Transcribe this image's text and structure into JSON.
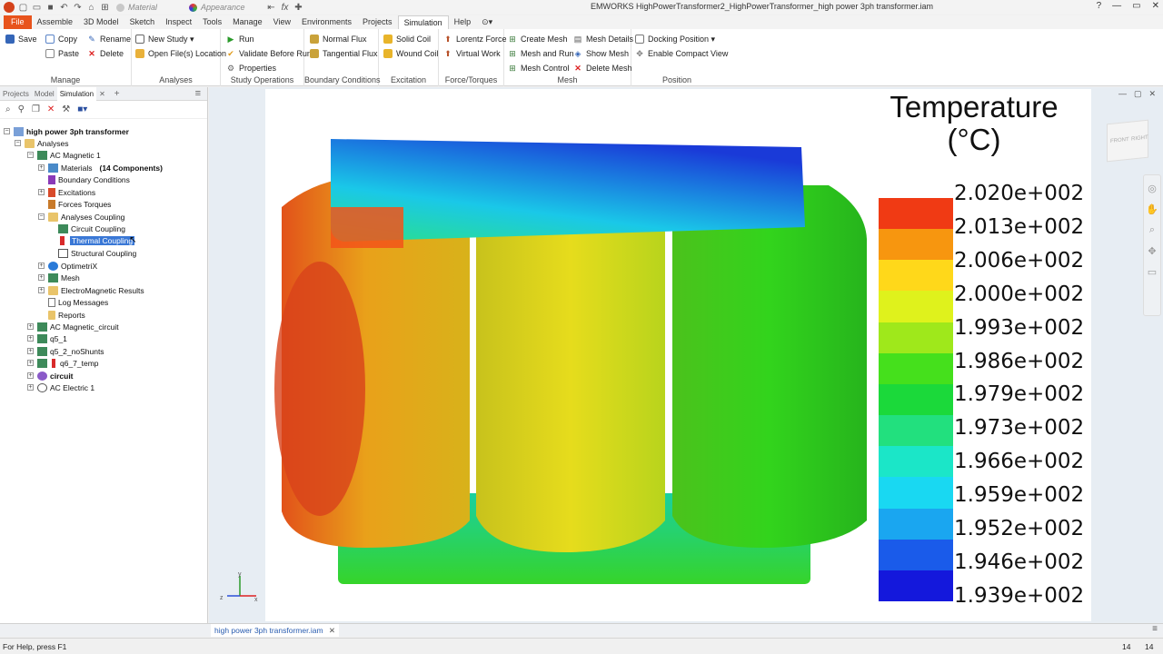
{
  "window": {
    "title": "EMWORKS   HighPowerTransformer2_HighPowerTransformer_high power 3ph transformer.iam",
    "material": "Material",
    "appearance": "Appearance",
    "fx": "fx",
    "help": "?",
    "minimize": "—",
    "restore": "▭",
    "close": "✕"
  },
  "tabs": [
    "File",
    "Assemble",
    "3D Model",
    "Sketch",
    "Inspect",
    "Tools",
    "Manage",
    "View",
    "Environments",
    "Projects",
    "Simulation",
    "Help"
  ],
  "active_tab": "Simulation",
  "ribbon": {
    "manage": {
      "label": "Manage",
      "save": "Save",
      "copy": "Copy",
      "paste": "Paste",
      "rename": "Rename",
      "delete": "Delete"
    },
    "analyses": {
      "label": "Analyses",
      "new_study": "New Study ▾",
      "open_location": "Open File(s) Location"
    },
    "study_ops": {
      "label": "Study Operations",
      "run": "Run",
      "validate": "Validate Before Run",
      "properties": "Properties"
    },
    "bc": {
      "label": "Boundary Conditions",
      "normal_flux": "Normal Flux",
      "tangential_flux": "Tangential Flux"
    },
    "excitation": {
      "label": "Excitation",
      "solid_coil": "Solid Coil",
      "wound_coil": "Wound Coil"
    },
    "force": {
      "label": "Force/Torques",
      "lorentz": "Lorentz Force",
      "virtual_work": "Virtual Work"
    },
    "mesh": {
      "label": "Mesh",
      "create": "Create Mesh",
      "mesh_run": "Mesh and Run",
      "control": "Mesh Control",
      "details": "Mesh Details",
      "show": "Show Mesh",
      "delete": "Delete Mesh"
    },
    "position": {
      "label": "Position",
      "docking": "Docking Position ▾",
      "compact": "Enable Compact View"
    }
  },
  "panel": {
    "tabs": [
      "Projects",
      "Model",
      "Simulation"
    ],
    "close": "✕",
    "add": "+",
    "menu": "≡"
  },
  "tree": {
    "root": "high power 3ph transformer",
    "analyses": "Analyses",
    "ac_magnetic_1": "AC Magnetic 1",
    "materials": "Materials",
    "materials_count": "(14 Components)",
    "boundary_conditions": "Boundary Conditions",
    "excitations": "Excitations",
    "forces_torques": "Forces Torques",
    "analyses_coupling": "Analyses Coupling",
    "circuit_coupling": "Circuit Coupling",
    "thermal_coupling": "Thermal Coupling",
    "structural_coupling": "Structural Coupling",
    "optimetrix": "OptimetriX",
    "mesh": "Mesh",
    "em_results": "ElectroMagnetic Results",
    "log": "Log Messages",
    "reports": "Reports",
    "ac_magnetic_circuit": "AC Magnetic_circuit",
    "q5_1": "q5_1",
    "q5_2": "q5_2_noShunts",
    "q6_7": "q6_7_temp",
    "circuit": "circuit",
    "ac_electric_1": "AC Electric 1"
  },
  "legend": {
    "title_line1": "Temperature",
    "title_line2": "(°C)",
    "labels": [
      "2.020e+002",
      "2.013e+002",
      "2.006e+002",
      "2.000e+002",
      "1.993e+002",
      "1.986e+002",
      "1.979e+002",
      "1.973e+002",
      "1.966e+002",
      "1.959e+002",
      "1.952e+002",
      "1.946e+002",
      "1.939e+002"
    ],
    "colors": [
      "#f03a14",
      "#f7960f",
      "#ffd81a",
      "#dff21c",
      "#9fe81b",
      "#45e01c",
      "#1bd93a",
      "#22e07e",
      "#1be6c8",
      "#19d8f2",
      "#1aa6f0",
      "#1a5bea",
      "#1418dc"
    ]
  },
  "viewcube": {
    "front": "FRONT",
    "right": "RIGHT"
  },
  "axes": {
    "x": "x",
    "y": "y",
    "z": "z"
  },
  "doc_tab": "high power 3ph transformer.iam",
  "doc_tab_close": "✕",
  "status": {
    "help": "For Help, press F1",
    "n1": "14",
    "n2": "14"
  }
}
